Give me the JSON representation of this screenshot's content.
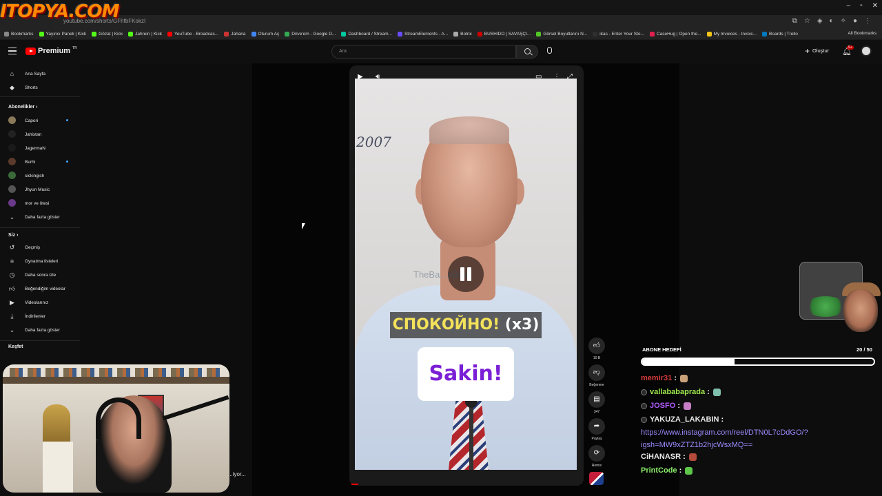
{
  "browser": {
    "tab_title": "",
    "url": "youtube.com/shorts/GFhfbFKokzI",
    "all_bookmarks": "All Bookmarks",
    "bookmarks": [
      {
        "label": "Bookmarks",
        "color": "#888888"
      },
      {
        "label": "Yayıncı Paneli | Kick",
        "color": "#53fc18"
      },
      {
        "label": "Gözat | Kick",
        "color": "#53fc18"
      },
      {
        "label": "Jahrein | Kick",
        "color": "#53fc18"
      },
      {
        "label": "YouTube - Broadcas...",
        "color": "#ff0000"
      },
      {
        "label": "Jaharia",
        "color": "#cc3333"
      },
      {
        "label": "Oturum Aç",
        "color": "#4285f4"
      },
      {
        "label": "Drive'em - Google D...",
        "color": "#34a853"
      },
      {
        "label": "Dashboard / Stream...",
        "color": "#00c8a0"
      },
      {
        "label": "StreamElements - A...",
        "color": "#6a4cff"
      },
      {
        "label": "Botrix",
        "color": "#aaaaaa"
      },
      {
        "label": "BUSHIDO | SAVAŞÇI...",
        "color": "#cc0000"
      },
      {
        "label": "Görsel Boyutlarını N...",
        "color": "#53c828"
      },
      {
        "label": "ikas - Enter Your Sto...",
        "color": "#2e2e2e"
      },
      {
        "label": "CaseHug | Open the...",
        "color": "#e01f4f"
      },
      {
        "label": "My Invoices - Invoic...",
        "color": "#f5c518"
      },
      {
        "label": "Boards | Trello",
        "color": "#0079bf"
      }
    ]
  },
  "overlay_logo": "ITOPYA.COM",
  "header": {
    "brand": "Premium",
    "brand_suffix": "TR",
    "search_placeholder": "Ara",
    "create_label": "Oluştur",
    "notif_count": "9+"
  },
  "sidebar": {
    "top": [
      {
        "label": "Ana Sayfa",
        "icon": "home-icon"
      },
      {
        "label": "Shorts",
        "icon": "shorts-icon"
      }
    ],
    "subs_title": "Abonelikler",
    "subs": [
      {
        "label": "Capori",
        "color": "#8a7a5a",
        "live": true
      },
      {
        "label": "Jahistan",
        "color": "#222222",
        "live": false
      },
      {
        "label": "JagermaN",
        "color": "#1a1a1a",
        "live": false
      },
      {
        "label": "Burhi",
        "color": "#5a3a2a",
        "live": true
      },
      {
        "label": "sickingish",
        "color": "#3a6a3a",
        "live": false
      },
      {
        "label": "Jhyun Music",
        "color": "#555555",
        "live": false
      },
      {
        "label": "mor ve ötesi",
        "color": "#6a3a8a",
        "live": false
      }
    ],
    "subs_more": "Daha fazla göster",
    "you_title": "Siz",
    "you": [
      {
        "label": "Geçmiş",
        "icon": "history-icon"
      },
      {
        "label": "Oynatma listeleri",
        "icon": "playlists-icon"
      },
      {
        "label": "Daha sonra izle",
        "icon": "watch-later-icon"
      },
      {
        "label": "Beğendiğim videolar",
        "icon": "liked-icon"
      },
      {
        "label": "Videolarınız",
        "icon": "your-videos-icon"
      },
      {
        "label": "İndirilenler",
        "icon": "downloads-icon"
      }
    ],
    "you_more": "Daha fazla göster",
    "explore_title": "Keşfet"
  },
  "video": {
    "year_text": "2007",
    "watermark": "TheBa...nBear",
    "subtitle_ru": "СПОКОЙНО!",
    "subtitle_ru_suffix": " (x3)",
    "subtitle_tr": "Sakin!",
    "progress": 0.03
  },
  "actions": [
    {
      "name": "like",
      "icon": "like-icon",
      "label": "10 B"
    },
    {
      "name": "dislike",
      "icon": "dislike-icon",
      "label": "Beğenme"
    },
    {
      "name": "comments",
      "icon": "comment-icon",
      "label": "347"
    },
    {
      "name": "share",
      "icon": "share-icon",
      "label": "Paylaş"
    },
    {
      "name": "remix",
      "icon": "remix-icon",
      "label": "Remix"
    }
  ],
  "webcam_caption": "...iyor...",
  "goal": {
    "title": "ABONE HEDEFİ",
    "current": 20,
    "target": 50,
    "count_text": "20 / 50"
  },
  "chat": [
    {
      "user": "memir31",
      "color": "#d63a3a",
      "badge": false,
      "emote": "#c9a27a",
      "text": ""
    },
    {
      "user": "vallababaprada",
      "color": "#9de94c",
      "badge": true,
      "emote": "#7fbfae",
      "text": ""
    },
    {
      "user": "JOSFO",
      "color": "#b05cff",
      "badge": true,
      "emote": "#c77ec7",
      "text": ""
    },
    {
      "user": "YAKUZA_LAKABIN",
      "color": "#e8e8e8",
      "badge": true,
      "emote": "",
      "text": ""
    },
    {
      "user": "CiHANASR",
      "color": "#e8e8e8",
      "badge": false,
      "emote": "#b34a3a",
      "text": ""
    },
    {
      "user": "PrintCode",
      "color": "#8cf06b",
      "badge": false,
      "emote": "#5ec74a",
      "text": ""
    }
  ],
  "chat_link_line1": "https://www.instagram.com/reel/DTN0L7cDdGO/?",
  "chat_link_line2": "igsh=MW9xZTZ1b2hjcWsxMQ==",
  "colors": {
    "accent_red": "#ff0000",
    "link": "#9c8cff",
    "subtitle_purple": "#7b1fd6"
  }
}
